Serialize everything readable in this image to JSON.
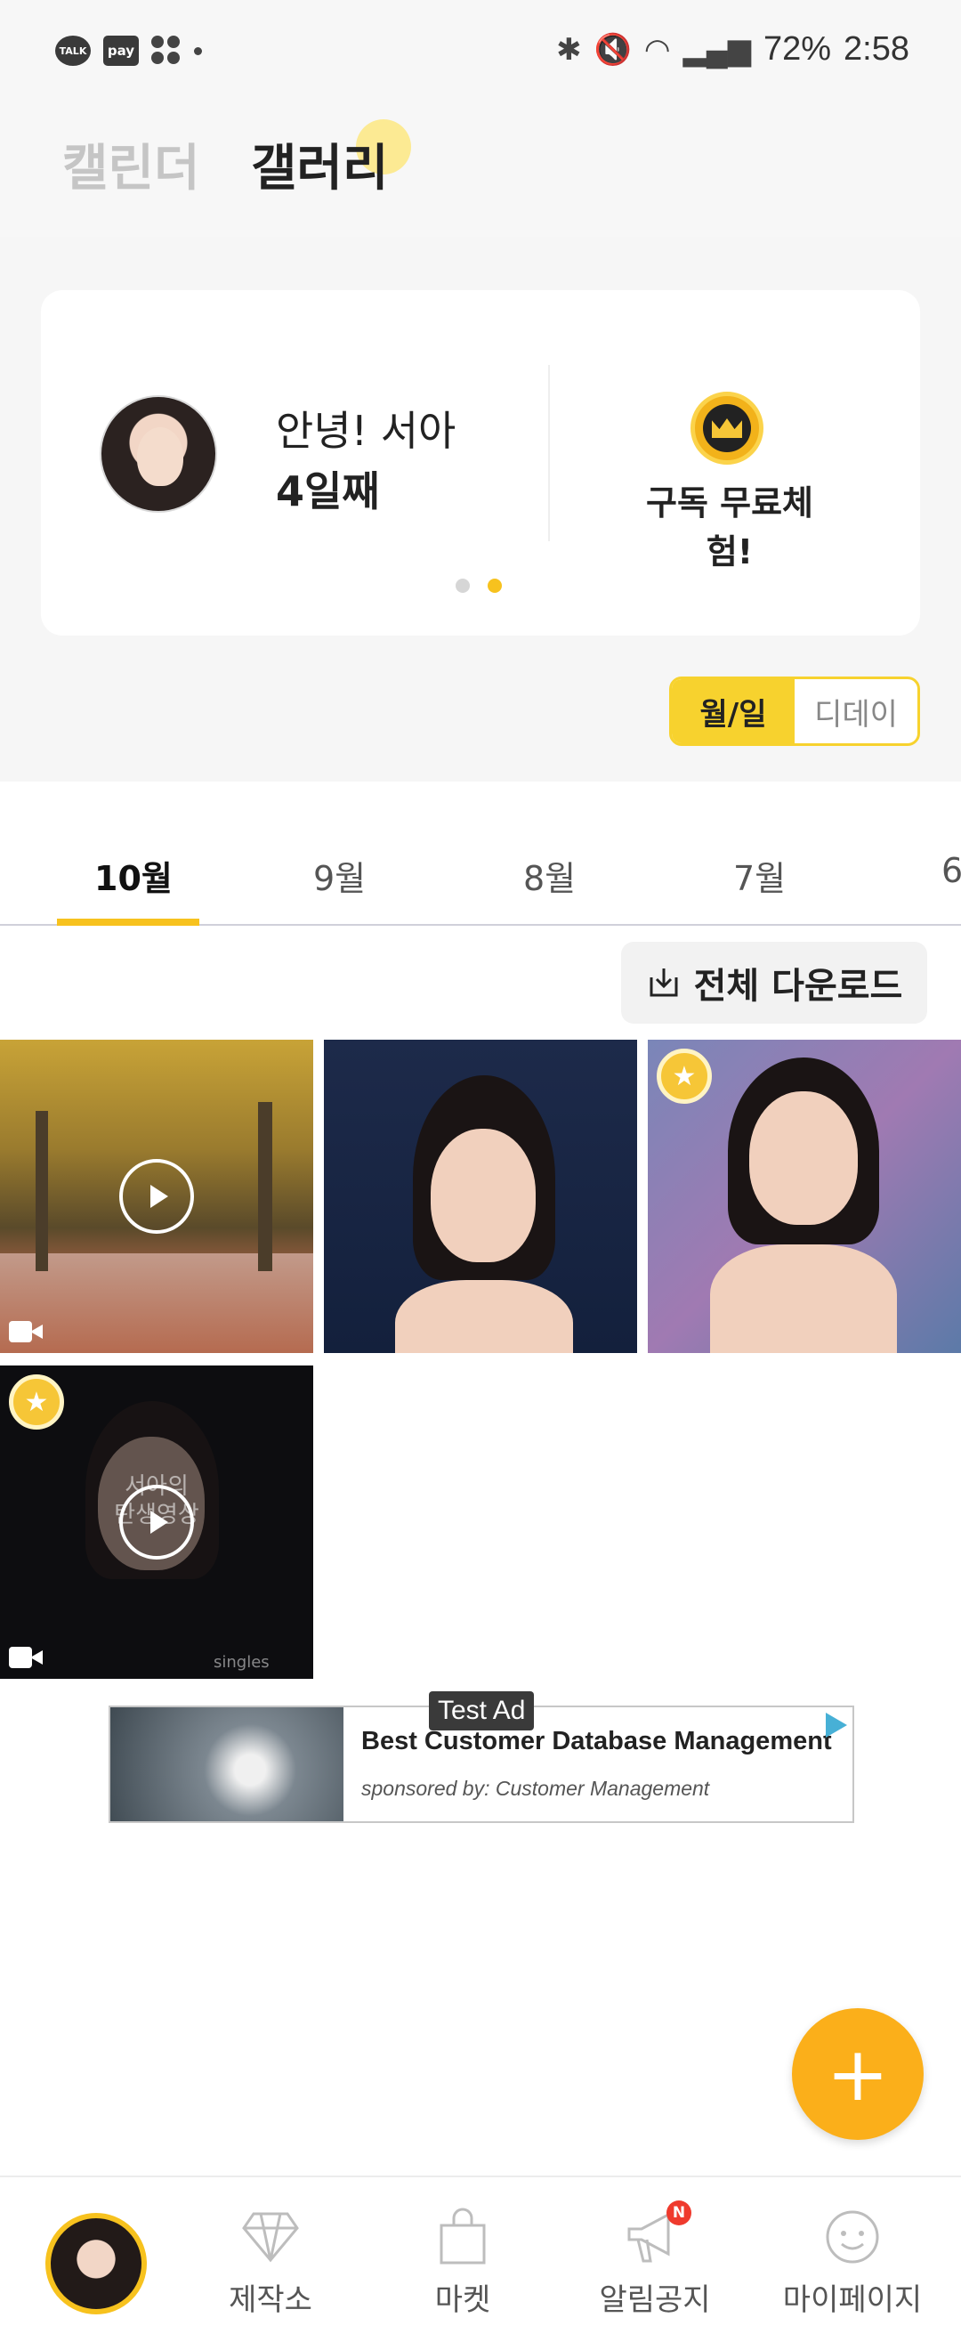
{
  "status_bar": {
    "talk_label": "TALK",
    "pay_label": "pay",
    "battery": "72%",
    "time": "2:58"
  },
  "header": {
    "tab_calendar": "캘린더",
    "tab_gallery": "갤러리"
  },
  "profile_card": {
    "greeting": "안녕! 서아",
    "days": "4일째",
    "subscription_label": "구독 무료체험!",
    "pager_total": 2,
    "pager_active": 2
  },
  "view_toggle": {
    "option_month_day": "월/일",
    "option_dday": "디데이",
    "selected": "월/일"
  },
  "months": [
    "10월",
    "9월",
    "8월",
    "7월",
    "6"
  ],
  "active_month": "10월",
  "download_all_label": "전체 다운로드",
  "gallery": {
    "overlay_text": "서아의\n탄생영상",
    "watermark": "singles"
  },
  "ad": {
    "tag": "Test Ad",
    "title": "Best Customer Database Management",
    "sponsor": "sponsored by: Customer Management"
  },
  "bottom_nav": {
    "items": [
      {
        "label": "",
        "icon": "profile-avatar"
      },
      {
        "label": "제작소",
        "icon": "diamond-icon"
      },
      {
        "label": "마켓",
        "icon": "shopping-bag-icon"
      },
      {
        "label": "알림공지",
        "icon": "megaphone-icon",
        "badge": "N"
      },
      {
        "label": "마이페이지",
        "icon": "smiley-icon"
      }
    ]
  },
  "colors": {
    "accent": "#f7c21e",
    "fab": "#fbaf1a",
    "badge_red": "#ef3a2d"
  }
}
